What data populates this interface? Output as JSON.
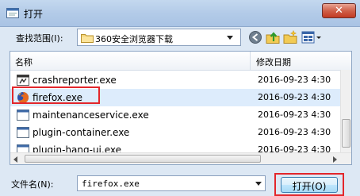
{
  "window": {
    "title": "打开",
    "close_label": "✕"
  },
  "toolbar": {
    "look_in_label": "查找范围(I):",
    "look_in_value": "360安全浏览器下载",
    "icons": [
      "back-icon",
      "up-folder-icon",
      "new-folder-icon",
      "view-menu-icon"
    ]
  },
  "list": {
    "columns": {
      "name": "名称",
      "date": "修改日期"
    },
    "rows": [
      {
        "name": "crashreporter.exe",
        "date": "2016-09-23 4:30",
        "icon": "crash-exe-icon"
      },
      {
        "name": "firefox.exe",
        "date": "2016-09-23 4:30",
        "icon": "firefox-icon",
        "selected": true
      },
      {
        "name": "maintenanceservice.exe",
        "date": "2016-09-23 4:30",
        "icon": "exe-icon"
      },
      {
        "name": "plugin-container.exe",
        "date": "2016-09-23 4:30",
        "icon": "exe-icon"
      },
      {
        "name": "plugin-hang-ui.exe",
        "date": "2016-09-23 4:30",
        "icon": "exe-icon"
      }
    ]
  },
  "footer": {
    "file_name_label": "文件名(N):",
    "file_name_value": "firefox.exe",
    "open_button": "打开(O)"
  },
  "colors": {
    "highlight": "#e3262b",
    "selection": "#ddecfc"
  }
}
